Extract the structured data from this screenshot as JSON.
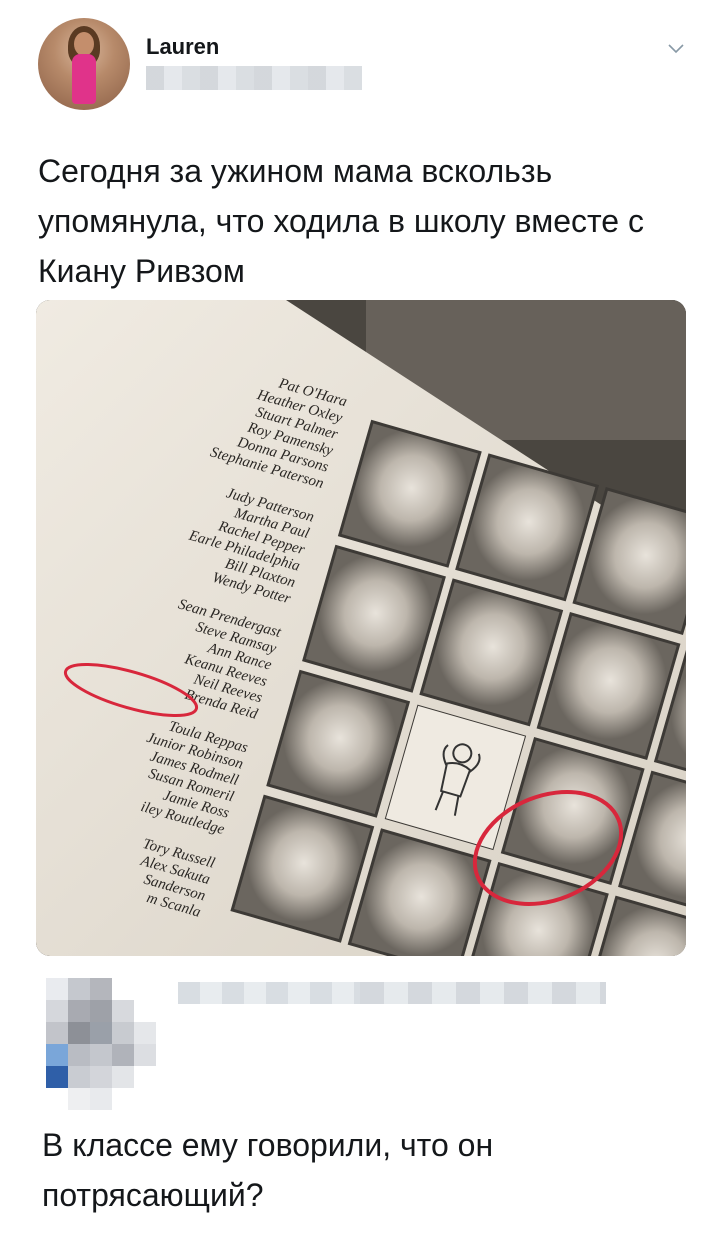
{
  "tweet": {
    "author_name": "Lauren",
    "text": "Сегодня за ужином мама вскользь упомянула, что ходила в школу вместе с Киану Ривзом"
  },
  "photo": {
    "name_groups": [
      [
        "Pat O'Hara",
        "Heather Oxley",
        "Stuart Palmer",
        "Roy Pamensky",
        "Donna Parsons",
        "Stephanie Paterson"
      ],
      [
        "Judy Patterson",
        "Martha Paul",
        "Rachel Pepper",
        "Earle Philadelphia",
        "Bill Plaxton",
        "Wendy Potter"
      ],
      [
        "Sean Prendergast",
        "Steve Ramsay",
        "Ann Rance",
        "Keanu Reeves",
        "Neil Reeves",
        "Brenda Reid"
      ],
      [
        "Toula Reppas",
        "Junior Robinson",
        "James Rodmell",
        "Susan Romeril",
        "Jamie Ross",
        "iley Routledge"
      ],
      [
        "Tory Russell",
        "Alex Sakuta",
        "Sanderson",
        "m Scanla"
      ]
    ]
  },
  "reply": {
    "text": "В классе ему говорили, что он потрясающий?"
  },
  "colors": {
    "circle": "#d8273c",
    "text": "#14171a"
  },
  "icons": {
    "menu": "chevron-down-icon"
  }
}
